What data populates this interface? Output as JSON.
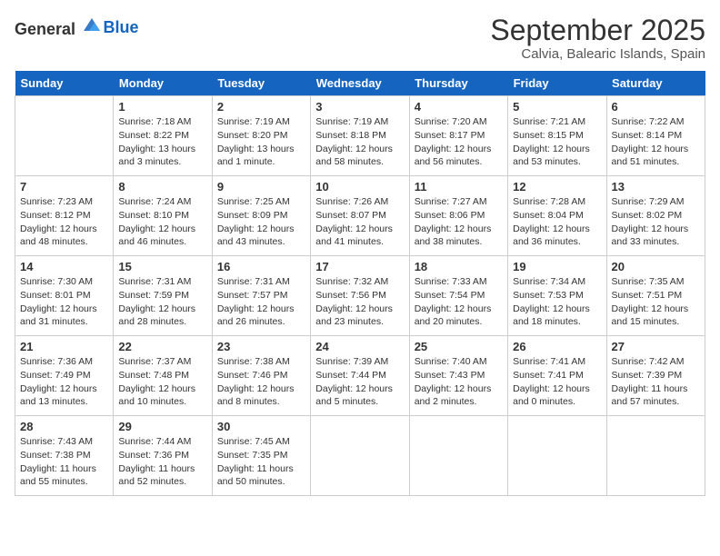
{
  "header": {
    "logo_general": "General",
    "logo_blue": "Blue",
    "title": "September 2025",
    "subtitle": "Calvia, Balearic Islands, Spain"
  },
  "days": [
    "Sunday",
    "Monday",
    "Tuesday",
    "Wednesday",
    "Thursday",
    "Friday",
    "Saturday"
  ],
  "weeks": [
    [
      {
        "date": "",
        "sunrise": "",
        "sunset": "",
        "daylight": ""
      },
      {
        "date": "1",
        "sunrise": "Sunrise: 7:18 AM",
        "sunset": "Sunset: 8:22 PM",
        "daylight": "Daylight: 13 hours and 3 minutes."
      },
      {
        "date": "2",
        "sunrise": "Sunrise: 7:19 AM",
        "sunset": "Sunset: 8:20 PM",
        "daylight": "Daylight: 13 hours and 1 minute."
      },
      {
        "date": "3",
        "sunrise": "Sunrise: 7:19 AM",
        "sunset": "Sunset: 8:18 PM",
        "daylight": "Daylight: 12 hours and 58 minutes."
      },
      {
        "date": "4",
        "sunrise": "Sunrise: 7:20 AM",
        "sunset": "Sunset: 8:17 PM",
        "daylight": "Daylight: 12 hours and 56 minutes."
      },
      {
        "date": "5",
        "sunrise": "Sunrise: 7:21 AM",
        "sunset": "Sunset: 8:15 PM",
        "daylight": "Daylight: 12 hours and 53 minutes."
      },
      {
        "date": "6",
        "sunrise": "Sunrise: 7:22 AM",
        "sunset": "Sunset: 8:14 PM",
        "daylight": "Daylight: 12 hours and 51 minutes."
      }
    ],
    [
      {
        "date": "7",
        "sunrise": "Sunrise: 7:23 AM",
        "sunset": "Sunset: 8:12 PM",
        "daylight": "Daylight: 12 hours and 48 minutes."
      },
      {
        "date": "8",
        "sunrise": "Sunrise: 7:24 AM",
        "sunset": "Sunset: 8:10 PM",
        "daylight": "Daylight: 12 hours and 46 minutes."
      },
      {
        "date": "9",
        "sunrise": "Sunrise: 7:25 AM",
        "sunset": "Sunset: 8:09 PM",
        "daylight": "Daylight: 12 hours and 43 minutes."
      },
      {
        "date": "10",
        "sunrise": "Sunrise: 7:26 AM",
        "sunset": "Sunset: 8:07 PM",
        "daylight": "Daylight: 12 hours and 41 minutes."
      },
      {
        "date": "11",
        "sunrise": "Sunrise: 7:27 AM",
        "sunset": "Sunset: 8:06 PM",
        "daylight": "Daylight: 12 hours and 38 minutes."
      },
      {
        "date": "12",
        "sunrise": "Sunrise: 7:28 AM",
        "sunset": "Sunset: 8:04 PM",
        "daylight": "Daylight: 12 hours and 36 minutes."
      },
      {
        "date": "13",
        "sunrise": "Sunrise: 7:29 AM",
        "sunset": "Sunset: 8:02 PM",
        "daylight": "Daylight: 12 hours and 33 minutes."
      }
    ],
    [
      {
        "date": "14",
        "sunrise": "Sunrise: 7:30 AM",
        "sunset": "Sunset: 8:01 PM",
        "daylight": "Daylight: 12 hours and 31 minutes."
      },
      {
        "date": "15",
        "sunrise": "Sunrise: 7:31 AM",
        "sunset": "Sunset: 7:59 PM",
        "daylight": "Daylight: 12 hours and 28 minutes."
      },
      {
        "date": "16",
        "sunrise": "Sunrise: 7:31 AM",
        "sunset": "Sunset: 7:57 PM",
        "daylight": "Daylight: 12 hours and 26 minutes."
      },
      {
        "date": "17",
        "sunrise": "Sunrise: 7:32 AM",
        "sunset": "Sunset: 7:56 PM",
        "daylight": "Daylight: 12 hours and 23 minutes."
      },
      {
        "date": "18",
        "sunrise": "Sunrise: 7:33 AM",
        "sunset": "Sunset: 7:54 PM",
        "daylight": "Daylight: 12 hours and 20 minutes."
      },
      {
        "date": "19",
        "sunrise": "Sunrise: 7:34 AM",
        "sunset": "Sunset: 7:53 PM",
        "daylight": "Daylight: 12 hours and 18 minutes."
      },
      {
        "date": "20",
        "sunrise": "Sunrise: 7:35 AM",
        "sunset": "Sunset: 7:51 PM",
        "daylight": "Daylight: 12 hours and 15 minutes."
      }
    ],
    [
      {
        "date": "21",
        "sunrise": "Sunrise: 7:36 AM",
        "sunset": "Sunset: 7:49 PM",
        "daylight": "Daylight: 12 hours and 13 minutes."
      },
      {
        "date": "22",
        "sunrise": "Sunrise: 7:37 AM",
        "sunset": "Sunset: 7:48 PM",
        "daylight": "Daylight: 12 hours and 10 minutes."
      },
      {
        "date": "23",
        "sunrise": "Sunrise: 7:38 AM",
        "sunset": "Sunset: 7:46 PM",
        "daylight": "Daylight: 12 hours and 8 minutes."
      },
      {
        "date": "24",
        "sunrise": "Sunrise: 7:39 AM",
        "sunset": "Sunset: 7:44 PM",
        "daylight": "Daylight: 12 hours and 5 minutes."
      },
      {
        "date": "25",
        "sunrise": "Sunrise: 7:40 AM",
        "sunset": "Sunset: 7:43 PM",
        "daylight": "Daylight: 12 hours and 2 minutes."
      },
      {
        "date": "26",
        "sunrise": "Sunrise: 7:41 AM",
        "sunset": "Sunset: 7:41 PM",
        "daylight": "Daylight: 12 hours and 0 minutes."
      },
      {
        "date": "27",
        "sunrise": "Sunrise: 7:42 AM",
        "sunset": "Sunset: 7:39 PM",
        "daylight": "Daylight: 11 hours and 57 minutes."
      }
    ],
    [
      {
        "date": "28",
        "sunrise": "Sunrise: 7:43 AM",
        "sunset": "Sunset: 7:38 PM",
        "daylight": "Daylight: 11 hours and 55 minutes."
      },
      {
        "date": "29",
        "sunrise": "Sunrise: 7:44 AM",
        "sunset": "Sunset: 7:36 PM",
        "daylight": "Daylight: 11 hours and 52 minutes."
      },
      {
        "date": "30",
        "sunrise": "Sunrise: 7:45 AM",
        "sunset": "Sunset: 7:35 PM",
        "daylight": "Daylight: 11 hours and 50 minutes."
      },
      {
        "date": "",
        "sunrise": "",
        "sunset": "",
        "daylight": ""
      },
      {
        "date": "",
        "sunrise": "",
        "sunset": "",
        "daylight": ""
      },
      {
        "date": "",
        "sunrise": "",
        "sunset": "",
        "daylight": ""
      },
      {
        "date": "",
        "sunrise": "",
        "sunset": "",
        "daylight": ""
      }
    ]
  ]
}
